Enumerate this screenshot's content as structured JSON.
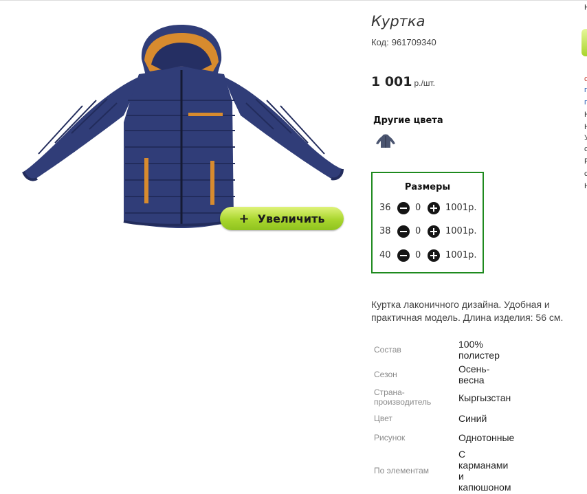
{
  "product": {
    "title": "Куртка",
    "code_label": "Код:",
    "code_value": "961709340",
    "price_value": "1 001",
    "price_unit": "р./шт.",
    "zoom_button": "Увеличить",
    "zoom_icon": "plus-icon",
    "other_colors_title": "Другие цвета",
    "description": "Куртка лаконичного дизайна. Удобная и практичная модель. Длина изделия: 56 см."
  },
  "sizes": {
    "title": "Размеры",
    "rows": [
      {
        "size": "36",
        "qty": "0",
        "price": "1001р."
      },
      {
        "size": "38",
        "qty": "0",
        "price": "1001р."
      },
      {
        "size": "40",
        "qty": "0",
        "price": "1001р."
      }
    ]
  },
  "attributes": [
    {
      "label": "Состав",
      "value": "100% полистер"
    },
    {
      "label": "Сезон",
      "value": "Осень-весна"
    },
    {
      "label": "Страна-производитель",
      "value": "Кыргызстан"
    },
    {
      "label": "Цвет",
      "value": "Синий"
    },
    {
      "label": "Рисунок",
      "value": "Однотонные"
    },
    {
      "label": "По элементам",
      "value": "С карманами и капюшоном"
    }
  ],
  "edge_letters": [
    "Н",
    "с",
    "п",
    "п",
    "Н",
    "Н",
    "У",
    "с",
    "Р",
    "с",
    "Н"
  ],
  "colors": {
    "jacket": "#303d78",
    "jacket_dark": "#222c5c",
    "trim": "#d88b2e",
    "box_border": "#1e8a1e",
    "zoom_green": "#a9d62e"
  }
}
